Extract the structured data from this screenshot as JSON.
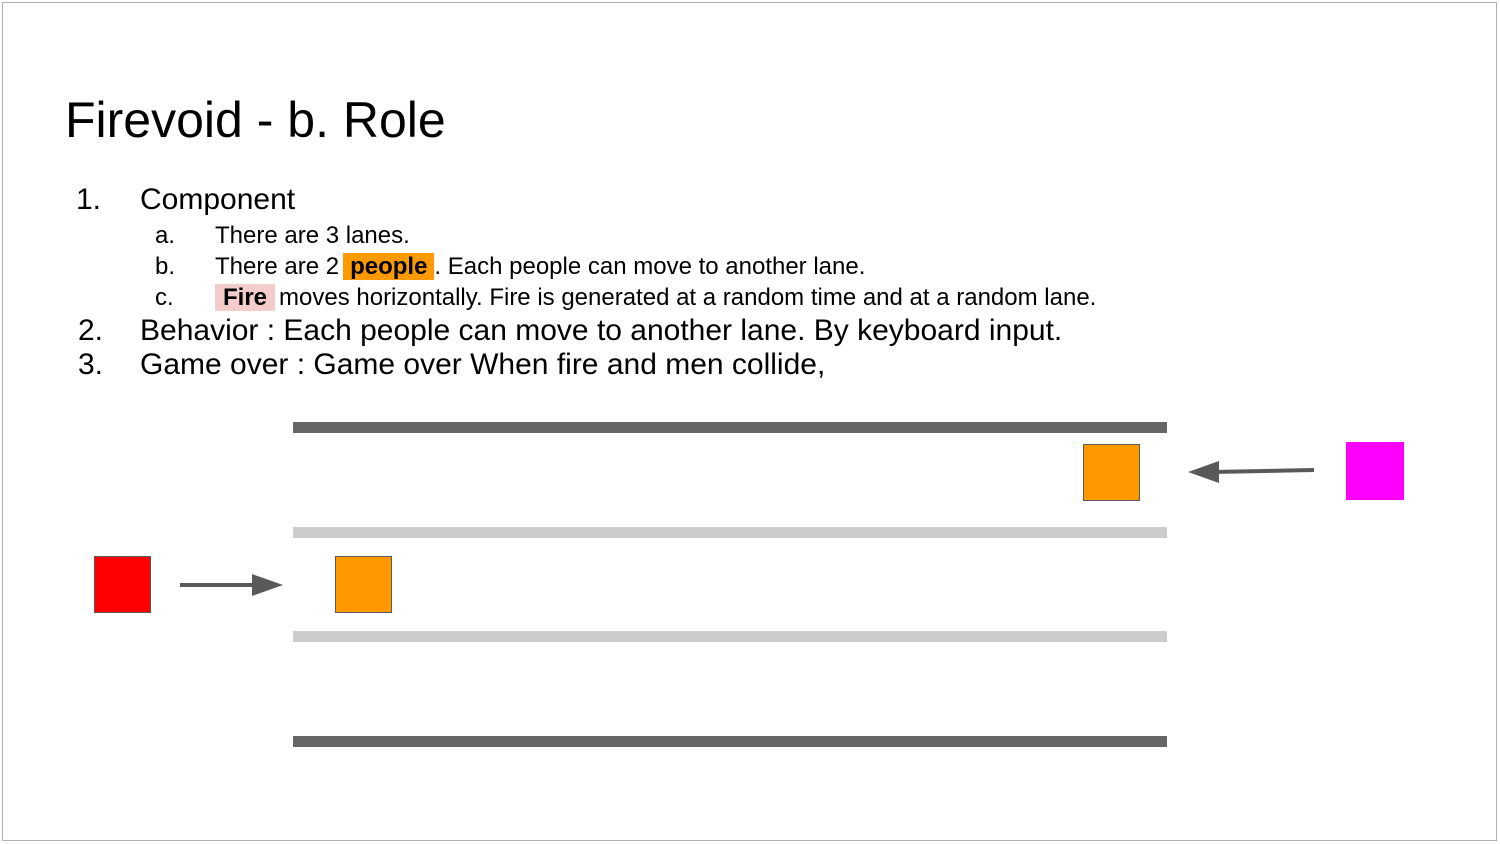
{
  "slide": {
    "title": "Firevoid - b. Role",
    "items": [
      {
        "marker": "1.",
        "text": "Component",
        "subitems": [
          {
            "marker": "a.",
            "text": "There are 3 lanes."
          },
          {
            "marker": "b.",
            "text_before": "There are 2",
            "highlight": "people",
            "text_after": ". Each people can move to another lane."
          },
          {
            "marker": "c.",
            "highlight": "Fire",
            "text_after": "moves horizontally. Fire is generated at a random time and at a random lane."
          }
        ]
      },
      {
        "marker": "2.",
        "text": "Behavior :  Each people can move to another lane. By keyboard input."
      },
      {
        "marker": "3.",
        "text": "Game over : Game over When fire and men collide,"
      }
    ]
  },
  "colors": {
    "people": "#ff9900",
    "fire_highlight": "#f4cccc",
    "fire_box": "#ff0000",
    "magenta_box": "#ff00ff",
    "lane_outer": "#666666",
    "lane_inner": "#cccccc",
    "arrow": "#595959"
  }
}
